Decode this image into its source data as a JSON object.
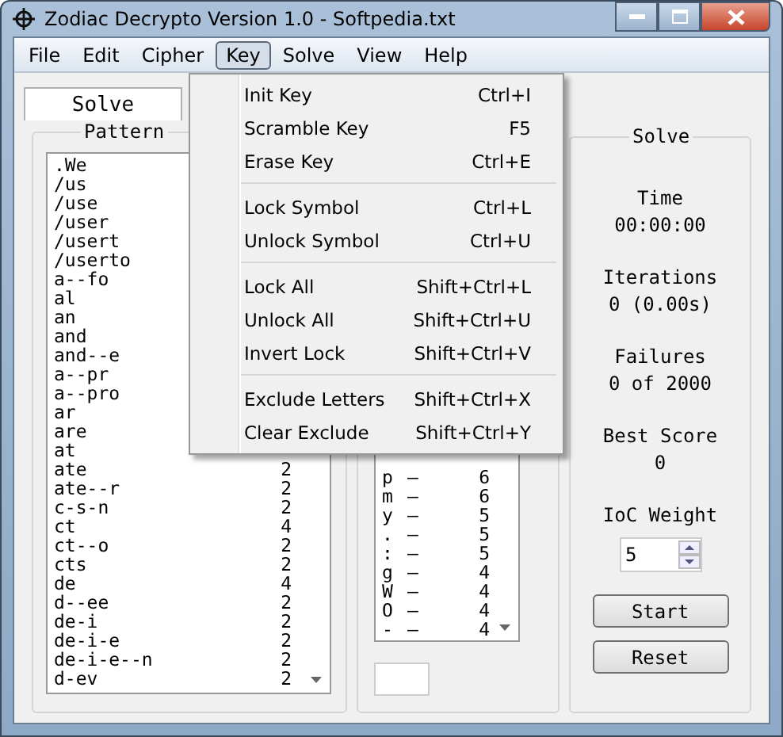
{
  "window": {
    "title": "Zodiac Decrypto Version 1.0 - Softpedia.txt"
  },
  "menu_bar": [
    {
      "label": "File",
      "selected": false
    },
    {
      "label": "Edit",
      "selected": false
    },
    {
      "label": "Cipher",
      "selected": false
    },
    {
      "label": "Key",
      "selected": true
    },
    {
      "label": "Solve",
      "selected": false
    },
    {
      "label": "View",
      "selected": false
    },
    {
      "label": "Help",
      "selected": false
    }
  ],
  "key_menu": [
    [
      {
        "label": "Init Key",
        "shortcut": "Ctrl+I"
      },
      {
        "label": "Scramble Key",
        "shortcut": "F5"
      },
      {
        "label": "Erase Key",
        "shortcut": "Ctrl+E"
      }
    ],
    [
      {
        "label": "Lock Symbol",
        "shortcut": "Ctrl+L"
      },
      {
        "label": "Unlock Symbol",
        "shortcut": "Ctrl+U"
      }
    ],
    [
      {
        "label": "Lock All",
        "shortcut": "Shift+Ctrl+L"
      },
      {
        "label": "Unlock All",
        "shortcut": "Shift+Ctrl+U"
      },
      {
        "label": "Invert Lock",
        "shortcut": "Shift+Ctrl+V"
      }
    ],
    [
      {
        "label": "Exclude Letters",
        "shortcut": "Shift+Ctrl+X"
      },
      {
        "label": "Clear Exclude",
        "shortcut": "Shift+Ctrl+Y"
      }
    ]
  ],
  "tabs": [
    {
      "label": "Solve",
      "selected": true
    }
  ],
  "patterns": {
    "title": "Pattern",
    "rows": [
      {
        "pattern": ".We"
      },
      {
        "pattern": "/us"
      },
      {
        "pattern": "/use"
      },
      {
        "pattern": "/user"
      },
      {
        "pattern": "/usert"
      },
      {
        "pattern": "/userto"
      },
      {
        "pattern": "a--fo"
      },
      {
        "pattern": "al"
      },
      {
        "pattern": "an"
      },
      {
        "pattern": "and"
      },
      {
        "pattern": "and--e"
      },
      {
        "pattern": "a--pr"
      },
      {
        "pattern": "a--pro"
      },
      {
        "pattern": "ar"
      },
      {
        "pattern": "are"
      },
      {
        "pattern": "at"
      },
      {
        "pattern": "ate",
        "count": "2"
      },
      {
        "pattern": "ate--r",
        "count": "2"
      },
      {
        "pattern": "c-s-n",
        "count": "2"
      },
      {
        "pattern": "ct",
        "count": "4"
      },
      {
        "pattern": "ct--o",
        "count": "2"
      },
      {
        "pattern": "cts",
        "count": "2"
      },
      {
        "pattern": "de",
        "count": "4"
      },
      {
        "pattern": "d--ee",
        "count": "2"
      },
      {
        "pattern": "de-i",
        "count": "2"
      },
      {
        "pattern": "de-i-e",
        "count": "2"
      },
      {
        "pattern": "de-i-e--n",
        "count": "2"
      },
      {
        "pattern": "d-ev",
        "count": "2"
      }
    ]
  },
  "symbols": {
    "rows": [
      {
        "symbol": "p",
        "letter": "–",
        "count": "6"
      },
      {
        "symbol": "m",
        "letter": "–",
        "count": "6"
      },
      {
        "symbol": "y",
        "letter": "–",
        "count": "5"
      },
      {
        "symbol": ".",
        "letter": "–",
        "count": "5"
      },
      {
        "symbol": ":",
        "letter": "–",
        "count": "5"
      },
      {
        "symbol": "g",
        "letter": "–",
        "count": "4"
      },
      {
        "symbol": "W",
        "letter": "–",
        "count": "4"
      },
      {
        "symbol": "O",
        "letter": "–",
        "count": "4"
      },
      {
        "symbol": "-",
        "letter": "–",
        "count": "4"
      }
    ]
  },
  "solve": {
    "title": "Solve",
    "stats": [
      {
        "label": "Time",
        "value": "00:00:00"
      },
      {
        "label": "Iterations",
        "value": "0 (0.00s)"
      },
      {
        "label": "Failures",
        "value": "0 of 2000"
      },
      {
        "label": "Best Score",
        "value": "0"
      }
    ],
    "ioc_label": "IoC Weight",
    "ioc_value": "5",
    "buttons": [
      "Start",
      "Reset"
    ]
  }
}
